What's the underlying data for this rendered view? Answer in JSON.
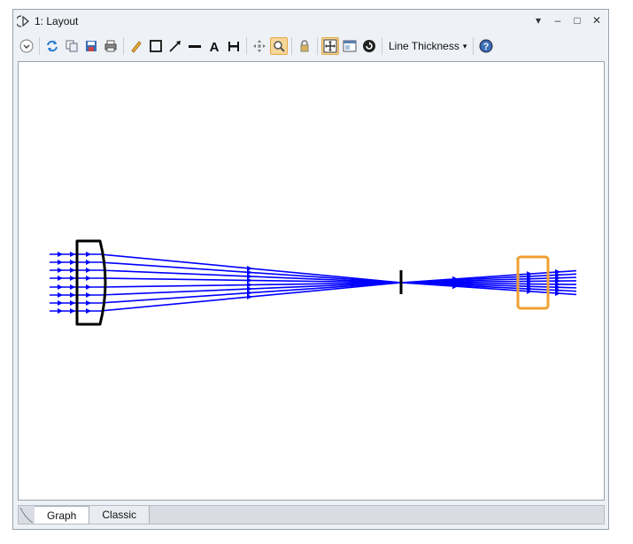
{
  "window": {
    "title": "1: Layout",
    "controls": [
      {
        "name": "dropdown-arrow-icon",
        "glyph": "▾"
      },
      {
        "name": "minimize-icon",
        "glyph": "–"
      },
      {
        "name": "maximize-icon",
        "glyph": "□"
      },
      {
        "name": "close-icon",
        "glyph": "✕"
      }
    ]
  },
  "toolbar": {
    "items": [
      "settings-chevron",
      "sep",
      "refresh",
      "copy",
      "save",
      "print",
      "sep",
      "pencil",
      "rectangle",
      "arrow",
      "line",
      "text",
      "dimension",
      "sep",
      "pan",
      "zoom",
      "sep",
      "lock",
      "sep",
      "fit",
      "window-layout",
      "rotate",
      "sep",
      "line-thickness",
      "sep",
      "help"
    ],
    "active_item": "zoom",
    "line_thickness_label": "Line Thickness"
  },
  "tabs": [
    {
      "label": "Graph",
      "selected": true
    },
    {
      "label": "Classic",
      "selected": false
    }
  ],
  "colors": {
    "rays": "#0000ff",
    "elements": "#000000",
    "highlight": "#f0a030"
  }
}
